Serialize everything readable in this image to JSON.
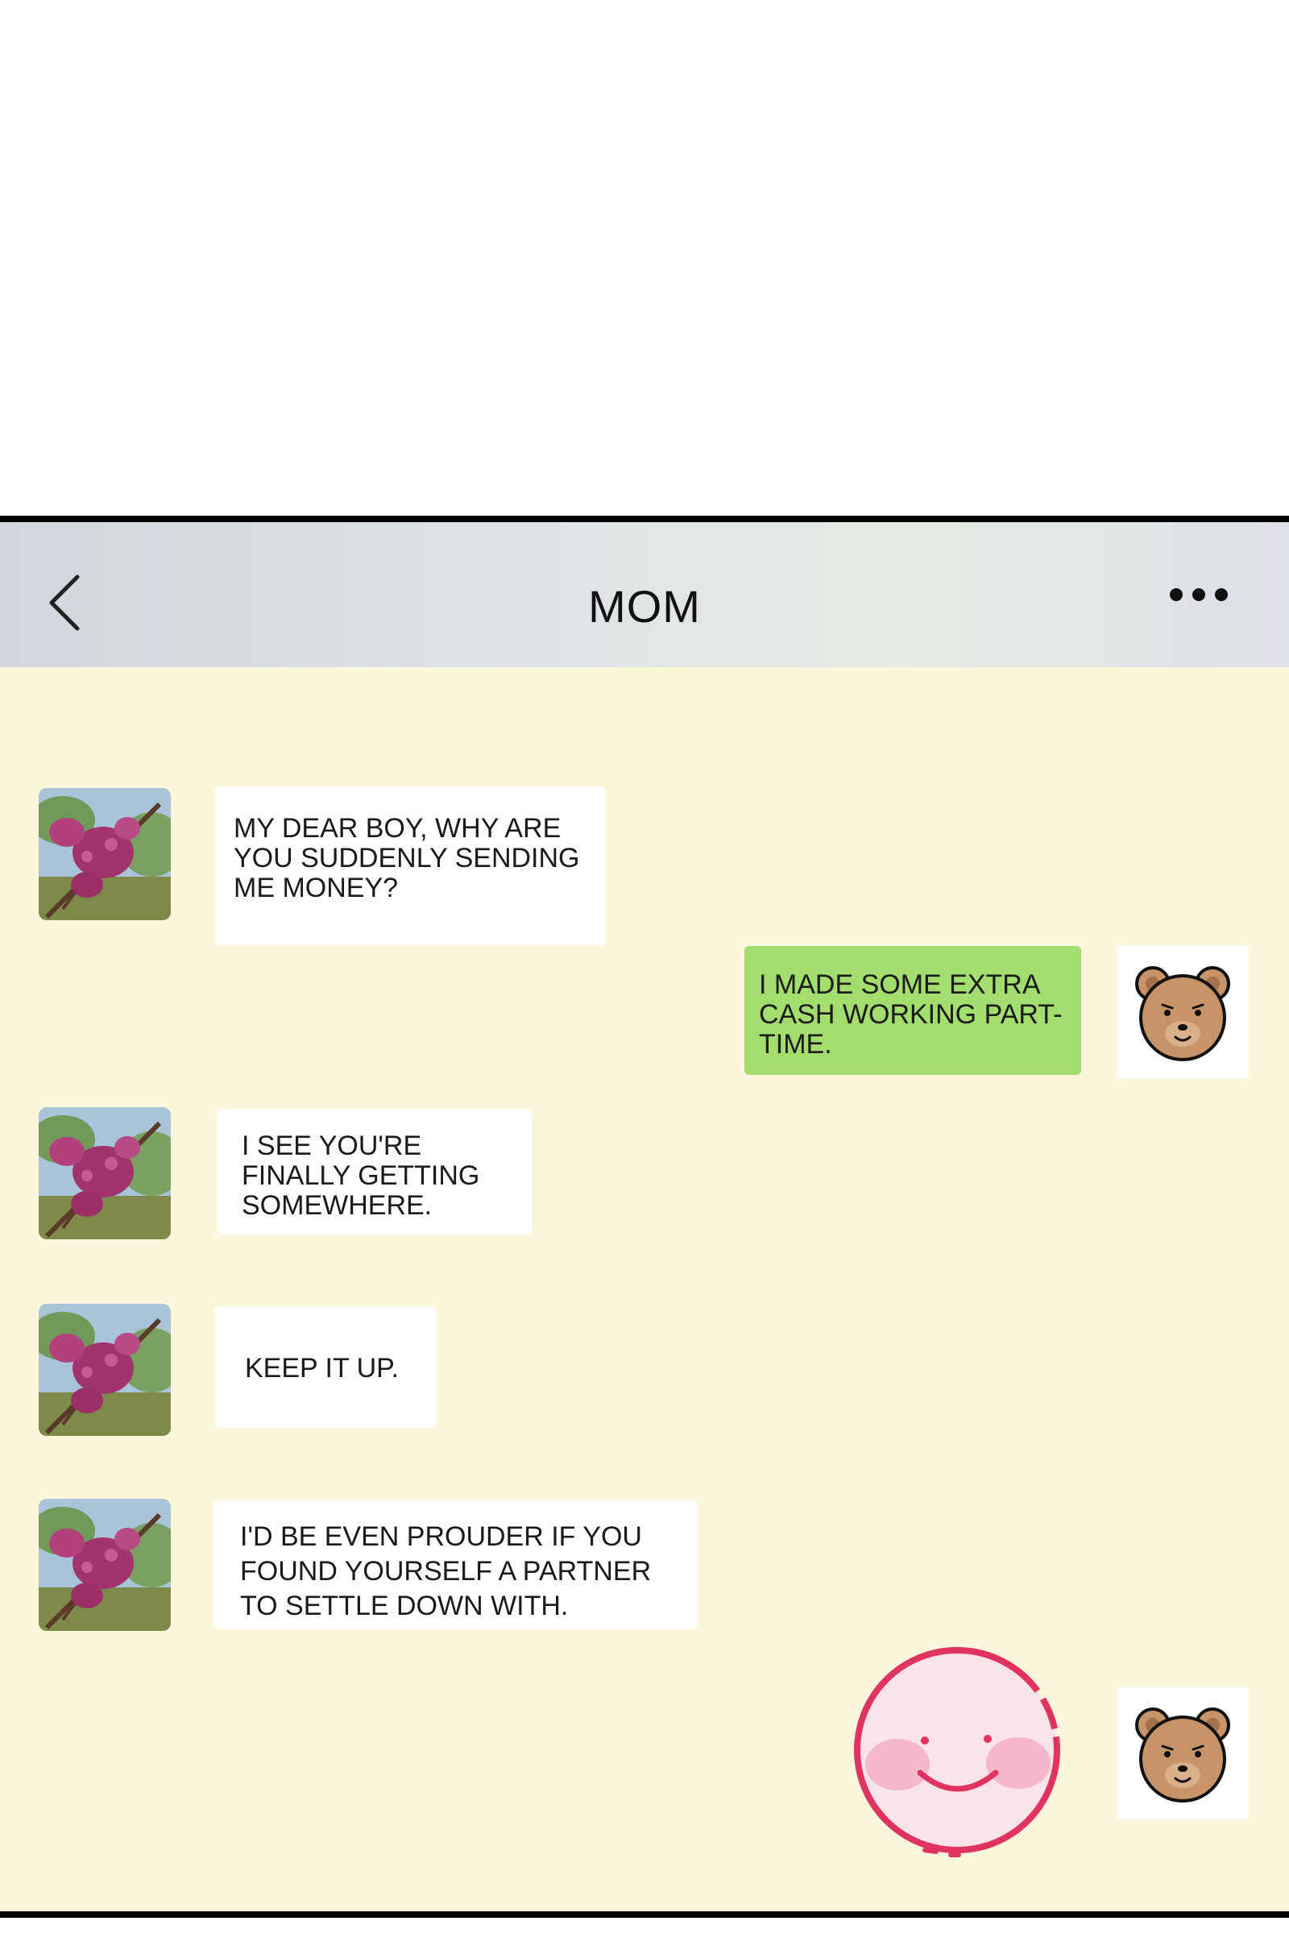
{
  "header": {
    "title": "MOM",
    "back_icon": "chevron-left-icon",
    "more_icon": "more-dots-icon"
  },
  "colors": {
    "chat_background": "#fcf7dc",
    "sent_bubble": "#a3dd6e",
    "received_bubble": "#ffffff",
    "header_background": "#dde1e4"
  },
  "messages": [
    {
      "sender": "mom",
      "text": "MY DEAR BOY, WHY ARE\nYOU SUDDENLY SENDING\nME MONEY?"
    },
    {
      "sender": "me",
      "text": "I MADE SOME EXTRA\nCASH WORKING PART-\nTIME."
    },
    {
      "sender": "mom",
      "text": "I SEE YOU'RE\nFINALLY GETTING\nSOMEWHERE."
    },
    {
      "sender": "mom",
      "text": "KEEP IT UP."
    },
    {
      "sender": "mom",
      "text": "I'D BE EVEN PROUDER IF YOU\nFOUND YOURSELF A PARTNER\nTO SETTLE DOWN WITH."
    },
    {
      "sender": "me",
      "sticker": "smiling-blush-face-sticker"
    }
  ],
  "avatars": {
    "mom": "flower-tree-photo",
    "me": "bear-face-icon"
  }
}
